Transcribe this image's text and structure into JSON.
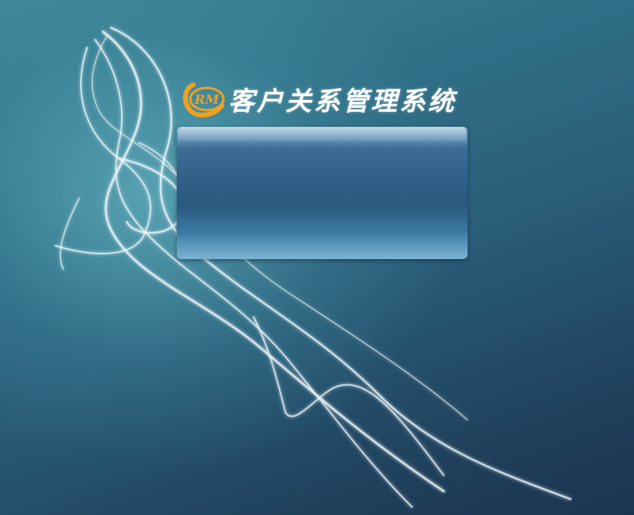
{
  "app": {
    "logo_text": "RM",
    "title": "客户关系管理系统"
  },
  "colors": {
    "logo_accent": "#f0a020",
    "background_top": "#3f8597",
    "background_bottom": "#1b3550",
    "panel": "#2f5e86"
  },
  "icons": {
    "logo": "crm-logo-icon"
  }
}
